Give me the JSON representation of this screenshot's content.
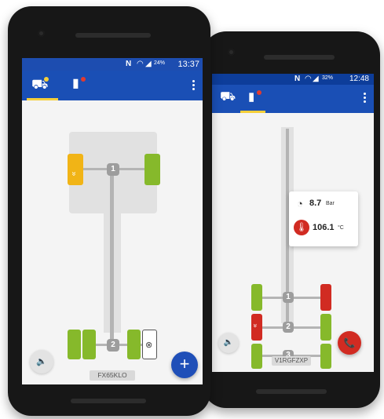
{
  "phone_left": {
    "status": {
      "network": "N",
      "battery": "24%",
      "time": "13:37"
    },
    "vehicle": {
      "plate": "FX65KLO",
      "hub_front": "1",
      "hub_rear": "2",
      "warning_glyph": "»"
    },
    "icons": {
      "tab1": "truck-status-icon",
      "tab2": "trailer-alert-icon",
      "more": "more-vert-icon",
      "sound": "volume-icon",
      "add": "add-icon"
    },
    "sound_glyph": "🔈",
    "add_glyph": "+",
    "empty_wheel_glyph": "⊗"
  },
  "phone_right": {
    "status": {
      "network": "N",
      "battery": "32%",
      "time": "12:48"
    },
    "vehicle": {
      "plate": "V1RGFZXP",
      "hub_1": "1",
      "hub_2": "2",
      "hub_3": "3",
      "warning_glyph": "»"
    },
    "popup": {
      "pressure_value": "8.7",
      "pressure_unit": "Bar",
      "temperature_value": "106.1",
      "temperature_unit": "°C"
    },
    "icons": {
      "tab1": "truck-status-icon",
      "tab2": "trailer-alert-icon",
      "more": "more-vert-icon",
      "sound": "volume-icon",
      "call": "phone-call-icon",
      "gauge": "gauge-icon",
      "thermometer": "thermometer-icon"
    },
    "sound_glyph": "🔈",
    "call_glyph": "📞",
    "gauge_glyph": "◔",
    "thermo_glyph": "🌡"
  },
  "colors": {
    "status_bar": "#0d3d9a",
    "app_bar": "#1a4fb5",
    "tab_underline": "#f5cf3a",
    "wheel_ok": "#86b92b",
    "wheel_warning": "#f1b416",
    "wheel_alert": "#d12b22",
    "fab_add": "#1f4fb8",
    "fab_call": "#d12b22"
  }
}
